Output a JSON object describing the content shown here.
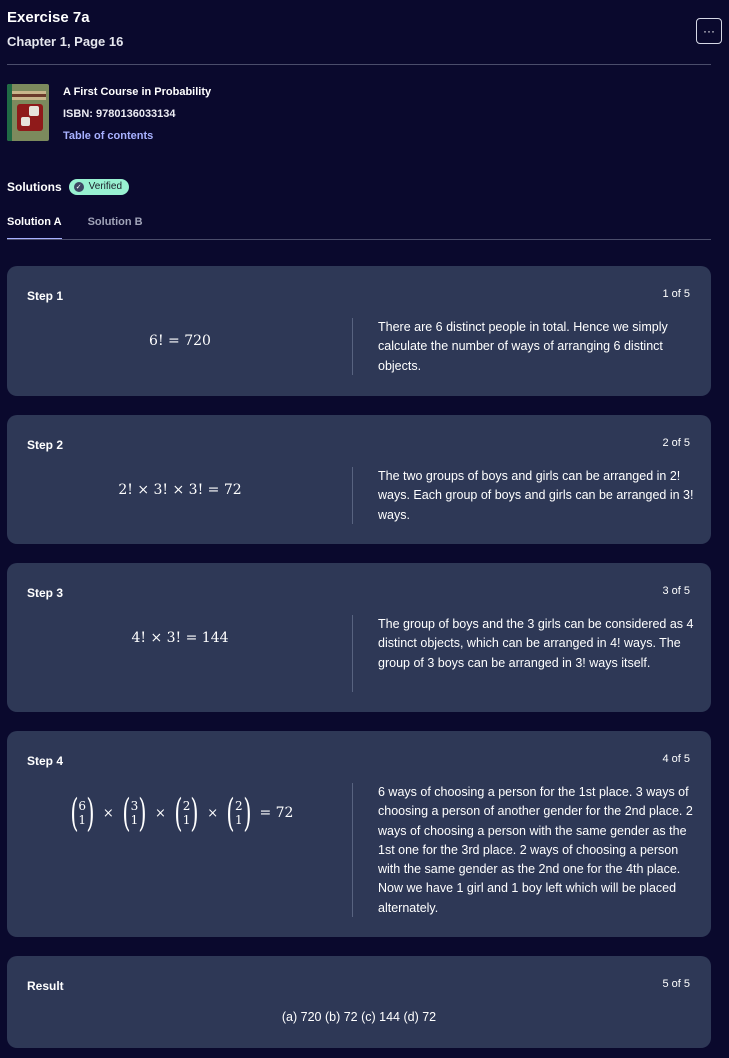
{
  "exercise": {
    "title": "Exercise 7a",
    "subtitle": "Chapter 1, Page 16"
  },
  "more_button": {
    "label": "···"
  },
  "book": {
    "title": "A First Course in Probability",
    "isbn": "ISBN: 9780136033134",
    "toc_link": "Table of contents"
  },
  "solutions": {
    "label": "Solutions",
    "badge": "Verified",
    "badge_color": "#98f1d1"
  },
  "tabs": [
    {
      "label": "Solution A",
      "active": true
    },
    {
      "label": "Solution B",
      "active": false
    }
  ],
  "steps": [
    {
      "label": "Step 1",
      "count": "1 of 5",
      "math": "6! = 720",
      "explanation": "There are 6 distinct people in total. Hence we simply calculate the number of ways of arranging 6 distinct objects."
    },
    {
      "label": "Step 2",
      "count": "2 of 5",
      "math": "2! × 3! × 3! = 72",
      "explanation": "The two groups of boys and girls can be arranged in 2! ways. Each group of boys and girls can be arranged in 3! ways."
    },
    {
      "label": "Step 3",
      "count": "3 of 5",
      "math": "4! × 3! = 144",
      "explanation": "The group of boys and the 3 girls can be considered as 4 distinct objects, which can be arranged in 4! ways. The group of 3 boys can be arranged in 3! ways itself."
    },
    {
      "label": "Step 4",
      "count": "4 of 5",
      "binomials": [
        {
          "top": "6",
          "bottom": "1"
        },
        {
          "top": "3",
          "bottom": "1"
        },
        {
          "top": "2",
          "bottom": "1"
        },
        {
          "top": "2",
          "bottom": "1"
        }
      ],
      "times": "×",
      "math_result": "= 72",
      "explanation": "6 ways of choosing a person for the 1st place. 3 ways of choosing a person of another gender for the 2nd place. 2 ways of choosing a person with the same gender as the 1st one for the 3rd place. 2 ways of choosing a person with the same gender as the 2nd one for the 4th place. Now we have 1 girl and 1 boy left which will be placed alternately."
    }
  ],
  "result": {
    "label": "Result",
    "count": "5 of 5",
    "text": "(a) 720 (b) 72 (c) 144 (d) 72"
  }
}
